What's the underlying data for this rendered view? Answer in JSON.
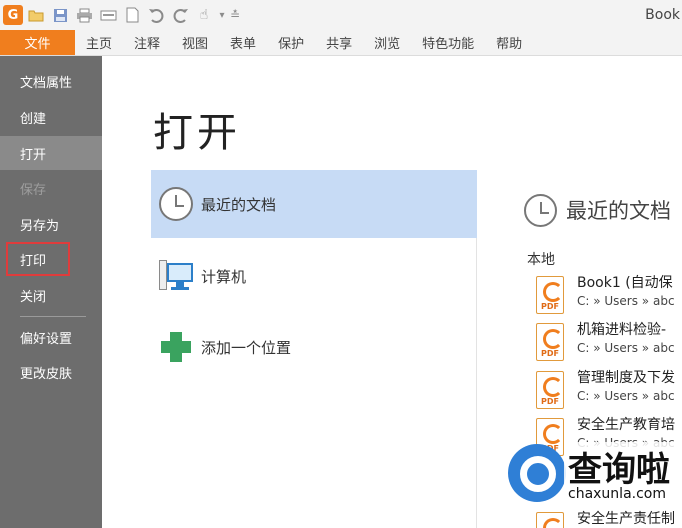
{
  "window": {
    "title": "Book"
  },
  "toolbar": {
    "icons": [
      "app-logo-icon",
      "open-folder-icon",
      "save-icon",
      "print-icon",
      "scan-icon",
      "new-document-icon",
      "undo-icon",
      "redo-icon",
      "hand-tool-icon",
      "dropdown-arrow-icon",
      "customize-icon"
    ],
    "logo_glyph": "G",
    "hand_glyph": "☝",
    "dropdown_glyph": "▾",
    "customize_glyph": "≛"
  },
  "tabs": {
    "file": "文件",
    "items": [
      "主页",
      "注释",
      "视图",
      "表单",
      "保护",
      "共享",
      "浏览",
      "特色功能",
      "帮助"
    ]
  },
  "menu": {
    "items": [
      {
        "label": "文档属性",
        "state": "normal"
      },
      {
        "label": "创建",
        "state": "normal"
      },
      {
        "label": "打开",
        "state": "active"
      },
      {
        "label": "保存",
        "state": "disabled"
      },
      {
        "label": "另存为",
        "state": "normal"
      },
      {
        "label": "打印",
        "state": "highlighted"
      },
      {
        "label": "关闭",
        "state": "normal"
      },
      {
        "label": "偏好设置",
        "state": "normal"
      },
      {
        "label": "更改皮肤",
        "state": "normal"
      }
    ]
  },
  "main": {
    "title": "打开",
    "places": [
      {
        "label": "最近的文档",
        "icon": "clock-icon",
        "selected": true
      },
      {
        "label": "计算机",
        "icon": "computer-icon",
        "selected": false
      },
      {
        "label": "添加一个位置",
        "icon": "plus-icon",
        "selected": false
      }
    ]
  },
  "recent": {
    "header": "最近的文档",
    "section": "本地",
    "docs": [
      {
        "name": "Book1 (自动保",
        "path": "C: » Users » abc"
      },
      {
        "name": "机箱进料检验-",
        "path": "C: » Users » abc"
      },
      {
        "name": "管理制度及下发",
        "path": "C: » Users » abc"
      },
      {
        "name": "安全生产教育培",
        "path": "C: » Users » abc"
      },
      {
        "name": "安全生产责任制",
        "path": ""
      }
    ],
    "doc_badge": "PDF"
  },
  "watermark": {
    "brand": "查询啦",
    "url": "chaxunla.com"
  },
  "colors": {
    "accent": "#f07e1e",
    "menu_bg": "#6d6d6d",
    "selected_bg": "#c7dbf5",
    "highlight_border": "#e03c3c"
  }
}
